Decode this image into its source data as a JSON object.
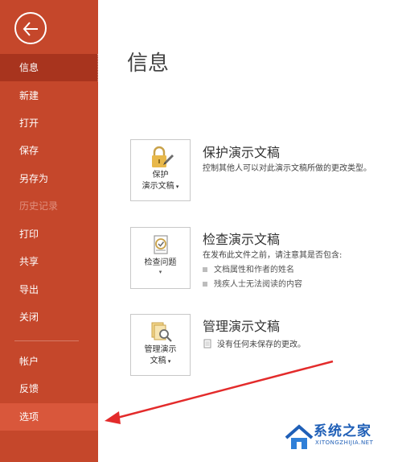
{
  "sidebar": {
    "items": [
      {
        "label": "信息",
        "state": "active"
      },
      {
        "label": "新建",
        "state": "normal"
      },
      {
        "label": "打开",
        "state": "normal"
      },
      {
        "label": "保存",
        "state": "normal"
      },
      {
        "label": "另存为",
        "state": "normal"
      },
      {
        "label": "历史记录",
        "state": "disabled"
      },
      {
        "label": "打印",
        "state": "normal"
      },
      {
        "label": "共享",
        "state": "normal"
      },
      {
        "label": "导出",
        "state": "normal"
      },
      {
        "label": "关闭",
        "state": "normal"
      },
      {
        "label": "帐户",
        "state": "normal"
      },
      {
        "label": "反馈",
        "state": "normal"
      },
      {
        "label": "选项",
        "state": "hover"
      }
    ],
    "accent": "#c5472b"
  },
  "main": {
    "title": "信息",
    "sections": [
      {
        "button_line1": "保护",
        "button_line2": "演示文稿",
        "title": "保护演示文稿",
        "desc": "控制其他人可以对此演示文稿所做的更改类型。",
        "icon": "lock-icon"
      },
      {
        "button_line1": "检查问题",
        "title": "检查演示文稿",
        "desc": "在发布此文件之前，请注意其是否包含:",
        "bullets": [
          "文档属性和作者的姓名",
          "残疾人士无法阅读的内容"
        ],
        "icon": "inspect-icon"
      },
      {
        "button_line1": "管理演示",
        "button_line2": "文稿",
        "title": "管理演示文稿",
        "desc": "没有任何未保存的更改。",
        "icon": "manage-versions-icon"
      }
    ]
  },
  "watermark": {
    "name": "系统之家",
    "url": "XITONGZHIJIA.NET"
  }
}
